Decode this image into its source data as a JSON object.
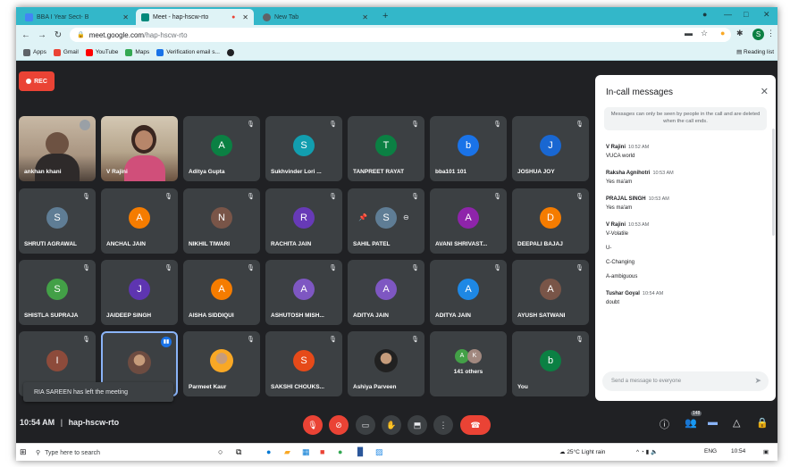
{
  "browser": {
    "tabs": [
      {
        "label": "BBA I Year Sect- B",
        "active": false,
        "color": "#4285f4"
      },
      {
        "label": "Meet - hap-hscw-rto",
        "active": true,
        "color": "#00897b"
      },
      {
        "label": "New Tab",
        "active": false,
        "color": "#5f6368"
      }
    ],
    "url_host": "meet.google.com",
    "url_path": "/hap-hscw-rto",
    "profile_initial": "S",
    "bookmarks": [
      {
        "label": "Apps",
        "color": "#5f6368"
      },
      {
        "label": "Gmail",
        "color": "#ea4335"
      },
      {
        "label": "YouTube",
        "color": "#ff0000"
      },
      {
        "label": "Maps",
        "color": "#34a853"
      },
      {
        "label": "Verification email s...",
        "color": "#1a73e8"
      }
    ],
    "reading_list": "Reading list"
  },
  "meet": {
    "rec_label": "REC",
    "tiles": [
      {
        "name": "ankhan khani",
        "initial": "",
        "color": "",
        "kind": "video1"
      },
      {
        "name": "V Rajini",
        "initial": "",
        "color": "",
        "kind": "video2"
      },
      {
        "name": "Aditya Gupta",
        "initial": "A",
        "color": "#0b8043"
      },
      {
        "name": "Sukhvinder Lori ...",
        "initial": "S",
        "color": "#129eaf"
      },
      {
        "name": "TANPREET RAYAT",
        "initial": "T",
        "color": "#0b8043"
      },
      {
        "name": "bba101 101",
        "initial": "b",
        "color": "#1a73e8"
      },
      {
        "name": "JOSHUA JOY",
        "initial": "J",
        "color": "#1967d2"
      },
      {
        "name": "SHRUTI AGRAWAL",
        "initial": "S",
        "color": "#5f7d95"
      },
      {
        "name": "ANCHAL JAIN",
        "initial": "A",
        "color": "#f57c00"
      },
      {
        "name": "NIKHIL TIWARI",
        "initial": "N",
        "color": "#795548"
      },
      {
        "name": "RACHITA JAIN",
        "initial": "R",
        "color": "#673ab7"
      },
      {
        "name": "SAHIL PATEL",
        "initial": "S",
        "color": "#5f7d95"
      },
      {
        "name": "AVANI SHRIVAST...",
        "initial": "A",
        "color": "#8e24aa"
      },
      {
        "name": "DEEPALI BAJAJ",
        "initial": "D",
        "color": "#f57c00"
      },
      {
        "name": "SHISTLA SUPRAJA",
        "initial": "S",
        "color": "#43a047"
      },
      {
        "name": "JAIDEEP SINGH",
        "initial": "J",
        "color": "#5e35b1"
      },
      {
        "name": "AISHA SIDDIQUI",
        "initial": "A",
        "color": "#f57c00"
      },
      {
        "name": "ASHUTOSH MISH...",
        "initial": "A",
        "color": "#7e57c2"
      },
      {
        "name": "ADITYA JAIN",
        "initial": "A",
        "color": "#7e57c2"
      },
      {
        "name": "ADITYA JAIN",
        "initial": "A",
        "color": "#1e88e5"
      },
      {
        "name": "AYUSH SATWANI",
        "initial": "A",
        "color": "#795548"
      },
      {
        "name": "",
        "initial": "I",
        "color": "#8d4b3b"
      },
      {
        "name": "",
        "initial": "",
        "color": "#6d4c41",
        "kind": "photo-selected"
      },
      {
        "name": "Parmeet Kaur",
        "initial": "",
        "color": "#f9a825",
        "kind": "photo"
      },
      {
        "name": "SAKSHI CHOUKS...",
        "initial": "S",
        "color": "#e64a19"
      },
      {
        "name": "Ashiya Parveen",
        "initial": "",
        "color": "#212121",
        "kind": "photo"
      },
      {
        "name": "",
        "initial": "",
        "color": "",
        "kind": "others"
      },
      {
        "name": "You",
        "initial": "b",
        "color": "#0b8043"
      }
    ],
    "others": {
      "label": "141 others",
      "initials": [
        "A",
        "K"
      ],
      "colors": [
        "#43a047",
        "#a1887f"
      ]
    },
    "toast": "RIA SAREEN has left the meeting",
    "time": "10:54 AM",
    "separator": "|",
    "meeting_code": "hap-hscw-rto",
    "people_count": "148"
  },
  "chat": {
    "title": "In-call messages",
    "notice": "Messages can only be seen by people in the call and are deleted when the call ends.",
    "messages": [
      {
        "from": "V Rajini",
        "time": "10:52 AM",
        "lines": [
          "VUCA world"
        ]
      },
      {
        "from": "Raksha Agnihotri",
        "time": "10:53 AM",
        "lines": [
          "Yes ma'am"
        ]
      },
      {
        "from": "PRAJAL SINGH",
        "time": "10:53 AM",
        "lines": [
          "Yes ma'am"
        ]
      },
      {
        "from": "V Rajini",
        "time": "10:53 AM",
        "lines": [
          "V-Volatile",
          "U-",
          "C-Changing",
          "A-ambiguous"
        ]
      },
      {
        "from": "Tushar Goyal",
        "time": "10:54 AM",
        "lines": [
          "doubt"
        ]
      }
    ],
    "input_placeholder": "Send a message to everyone"
  },
  "taskbar": {
    "search_placeholder": "Type here to search",
    "weather": "25°C  Light rain",
    "lang": "ENG",
    "clock": "10:54"
  }
}
